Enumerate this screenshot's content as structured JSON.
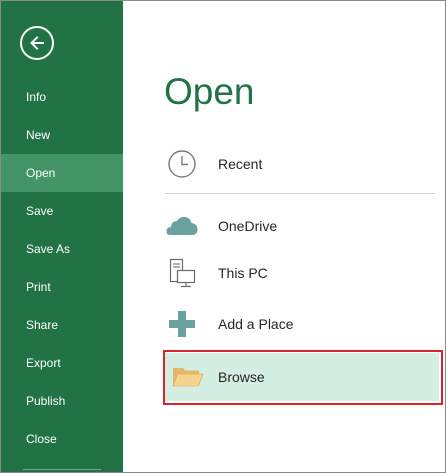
{
  "sidebar": {
    "items": [
      {
        "label": "Info"
      },
      {
        "label": "New"
      },
      {
        "label": "Open",
        "active": true
      },
      {
        "label": "Save"
      },
      {
        "label": "Save As"
      },
      {
        "label": "Print"
      },
      {
        "label": "Share"
      },
      {
        "label": "Export"
      },
      {
        "label": "Publish"
      },
      {
        "label": "Close"
      }
    ],
    "back_icon": "back-arrow-icon"
  },
  "main": {
    "title": "Open",
    "locations": [
      {
        "label": "Recent",
        "icon": "clock-icon"
      },
      {
        "label": "OneDrive",
        "icon": "cloud-icon"
      },
      {
        "label": "This PC",
        "icon": "computer-icon"
      },
      {
        "label": "Add a Place",
        "icon": "plus-icon"
      },
      {
        "label": "Browse",
        "icon": "folder-icon",
        "highlighted": true
      }
    ]
  },
  "colors": {
    "sidebar": "#217346",
    "sidebar_active": "#439467",
    "title": "#217346",
    "browse_background": "#d4efe1",
    "highlight_border": "#d9232d"
  }
}
